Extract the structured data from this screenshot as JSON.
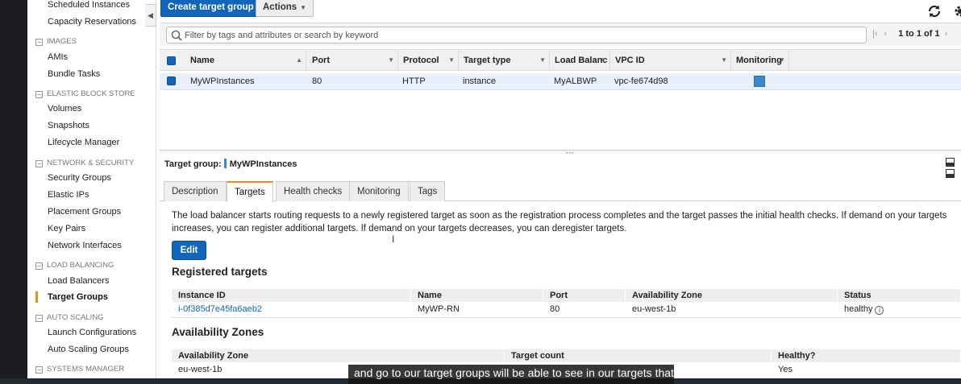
{
  "sidebar": {
    "items_top": [
      "Scheduled Instances",
      "Capacity Reservations"
    ],
    "sections": [
      {
        "title": "IMAGES",
        "items": [
          "AMIs",
          "Bundle Tasks"
        ]
      },
      {
        "title": "ELASTIC BLOCK STORE",
        "items": [
          "Volumes",
          "Snapshots",
          "Lifecycle Manager"
        ]
      },
      {
        "title": "NETWORK & SECURITY",
        "items": [
          "Security Groups",
          "Elastic IPs",
          "Placement Groups",
          "Key Pairs",
          "Network Interfaces"
        ]
      },
      {
        "title": "LOAD BALANCING",
        "items": [
          "Load Balancers",
          "Target Groups"
        ]
      },
      {
        "title": "AUTO SCALING",
        "items": [
          "Launch Configurations",
          "Auto Scaling Groups"
        ]
      },
      {
        "title": "SYSTEMS MANAGER",
        "items": []
      }
    ],
    "active_item": "Target Groups",
    "toggle_symbol": "−"
  },
  "toolbar": {
    "create_label": "Create target group",
    "actions_label": "Actions"
  },
  "search": {
    "placeholder": "Filter by tags and attributes or search by keyword"
  },
  "pager": {
    "count": "1 to 1 of 1"
  },
  "grid": {
    "columns": [
      "Name",
      "Port",
      "Protocol",
      "Target type",
      "Load Balanc",
      "VPC ID",
      "Monitoring"
    ],
    "rows": [
      {
        "name": "MyWPInstances",
        "port": "80",
        "protocol": "HTTP",
        "target_type": "instance",
        "load_balancer": "MyALBWP",
        "vpc_id": "vpc-fe674d98"
      }
    ]
  },
  "detail": {
    "label": "Target group:",
    "name": "MyWPInstances",
    "tabs": [
      "Description",
      "Targets",
      "Health checks",
      "Monitoring",
      "Tags"
    ],
    "active_tab": "Targets",
    "description": "The load balancer starts routing requests to a newly registered target as soon as the registration process completes and the target passes the initial health checks. If demand on your targets increases, you can register additional targets. If demand on your targets decreases, you can deregister targets.",
    "edit_label": "Edit",
    "registered_title": "Registered targets",
    "registered_columns": [
      "Instance ID",
      "Name",
      "Port",
      "Availability Zone",
      "Status"
    ],
    "registered_rows": [
      {
        "instance_id": "i-0f385d7e45fa6aeb2",
        "name": "MyWP-RN",
        "port": "80",
        "az": "eu-west-1b",
        "status": "healthy"
      }
    ],
    "az_title": "Availability Zones",
    "az_columns": [
      "Availability Zone",
      "Target count",
      "Healthy?"
    ],
    "az_rows": [
      {
        "az": "eu-west-1b",
        "count": "",
        "healthy": "Yes"
      }
    ]
  },
  "caption": {
    "text": "and go to our target groups will be able to see in our targets that"
  },
  "colors": {
    "primary": "#1166bb",
    "accent": "#e88f1d",
    "row_selected": "#e8f1fb"
  }
}
